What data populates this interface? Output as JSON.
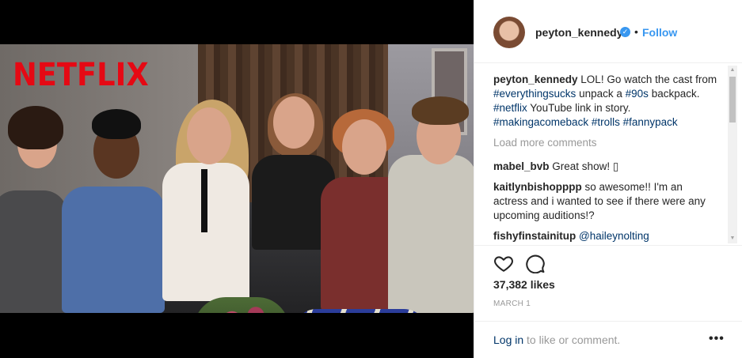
{
  "media": {
    "brand_logo_text": "NETFLIX",
    "logo_color": "#e50914"
  },
  "post": {
    "header": {
      "username": "peyton_kennedy",
      "verified_icon": "verified-check-icon",
      "separator": "•",
      "follow_label": "Follow"
    },
    "caption": {
      "username": "peyton_kennedy",
      "text_1": "LOL! Go watch the cast from",
      "tag_1": "#everythingsucks",
      "text_2": "unpack a",
      "tag_2": "#90s",
      "text_3": "backpack.",
      "tag_3": "#netflix",
      "text_4": "YouTube link in story.",
      "tag_4": "#makingacomeback",
      "tag_5": "#trolls",
      "tag_6": "#fannypack"
    },
    "load_more_label": "Load more comments",
    "comments": [
      {
        "username": "mabel_bvb",
        "text": "Great show! ▯"
      },
      {
        "username": "kaitlynbishopppp",
        "text": "so awesome!! I'm an actress and i wanted to see if there were any upcoming auditions!?"
      },
      {
        "username": "fishyfinstainitup",
        "mention": "@haileynolting"
      }
    ],
    "actions": {
      "like_icon": "heart-icon",
      "comment_icon": "comment-icon",
      "likes_label": "37,382 likes",
      "date": "MARCH 1"
    },
    "footer": {
      "login_link": "Log in",
      "login_text": "to like or comment.",
      "more_label": "•••"
    },
    "colors": {
      "link_blue": "#3897f0",
      "tag_blue": "#003569",
      "muted": "#999999"
    }
  }
}
